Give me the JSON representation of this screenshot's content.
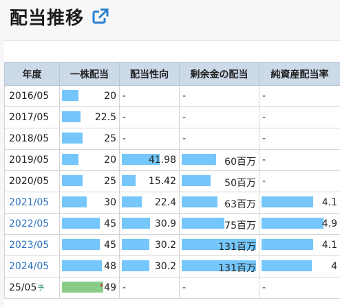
{
  "page": {
    "title": "配当推移",
    "link_icon": "external-link-icon"
  },
  "colors": {
    "header_bg": "#ccd9e8",
    "bar": "#74c6fb",
    "forecast_bar": "#88cc88",
    "link": "#2a6fbf"
  },
  "table": {
    "headers": [
      "年度",
      "一株配当",
      "配当性向",
      "剰余金の配当",
      "純資産配当率"
    ],
    "rows": [
      {
        "year": "2016/05",
        "dps": "20",
        "dps_v": 20,
        "payout": "-",
        "payout_v": null,
        "surplus": "-",
        "surplus_v": null,
        "equity": "-",
        "equity_v": null
      },
      {
        "year": "2017/05",
        "dps": "22.5",
        "dps_v": 22.5,
        "payout": "-",
        "payout_v": null,
        "surplus": "-",
        "surplus_v": null,
        "equity": "-",
        "equity_v": null
      },
      {
        "year": "2018/05",
        "dps": "25",
        "dps_v": 25,
        "payout": "-",
        "payout_v": null,
        "surplus": "-",
        "surplus_v": null,
        "equity": "-",
        "equity_v": null
      },
      {
        "year": "2019/05",
        "dps": "20",
        "dps_v": 20,
        "payout": "41.98",
        "payout_v": 41.98,
        "surplus": "60百万",
        "surplus_v": 60,
        "equity": "-",
        "equity_v": null
      },
      {
        "year": "2020/05",
        "dps": "25",
        "dps_v": 25,
        "payout": "15.42",
        "payout_v": 15.42,
        "surplus": "50百万",
        "surplus_v": 50,
        "equity": "-",
        "equity_v": null
      },
      {
        "year": "2021/05",
        "dps": "30",
        "dps_v": 30,
        "payout": "22.4",
        "payout_v": 22.4,
        "surplus": "63百万",
        "surplus_v": 63,
        "equity": "4.1",
        "equity_v": 4.1,
        "link": true
      },
      {
        "year": "2022/05",
        "dps": "45",
        "dps_v": 45,
        "payout": "30.9",
        "payout_v": 30.9,
        "surplus": "75百万",
        "surplus_v": 75,
        "equity": "4.9",
        "equity_v": 4.9,
        "link": true
      },
      {
        "year": "2023/05",
        "dps": "45",
        "dps_v": 45,
        "payout": "30.2",
        "payout_v": 30.2,
        "surplus": "131百万",
        "surplus_v": 131,
        "equity": "4.1",
        "equity_v": 4.1,
        "link": true
      },
      {
        "year": "2024/05",
        "dps": "48",
        "dps_v": 48,
        "payout": "30.2",
        "payout_v": 30.2,
        "surplus": "131百万",
        "surplus_v": 131,
        "equity": "4",
        "equity_v": 4,
        "link": true
      },
      {
        "year": "25/05",
        "yo": "予",
        "dps": "49",
        "dps_v": 49,
        "forecast": true,
        "forecast_mark": "*",
        "payout": "-",
        "payout_v": null,
        "surplus": "-",
        "surplus_v": null,
        "equity": "-",
        "equity_v": null
      }
    ]
  }
}
